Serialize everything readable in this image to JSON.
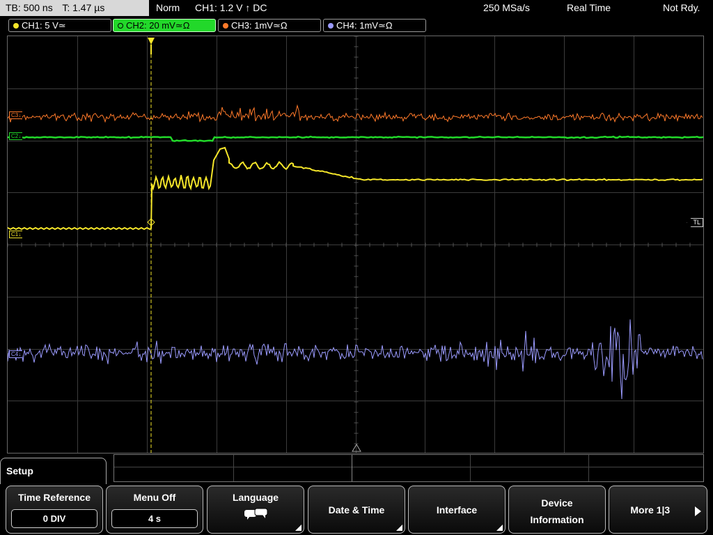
{
  "status": {
    "timebase": "TB: 500 ns",
    "trigger_time": "T: 1.47 µs",
    "mode": "Norm",
    "trigger": "CH1: 1.2 V ↑ DC",
    "sample_rate": "250 MSa/s",
    "acq": "Real Time",
    "state": "Not Rdy."
  },
  "channels": [
    {
      "label": "CH1: 5 V≃",
      "color": "#f5e62a"
    },
    {
      "label": "CH2: 20 mV≃Ω",
      "color": "#22d82a"
    },
    {
      "label": "CH3: 1mV≃Ω",
      "color": "#ff7a2a"
    },
    {
      "label": "CH4: 1mV≃Ω",
      "color": "#9b9bff"
    }
  ],
  "markers": {
    "c3": "C3↓",
    "c2": "C2↓",
    "c1": "C1↓",
    "c4": "C4↓",
    "tl": "TL"
  },
  "menu": {
    "title": "Setup",
    "time_reference": {
      "label": "Time Reference",
      "value": "0 DIV"
    },
    "menu_off": {
      "label": "Menu Off",
      "value": "4 s"
    },
    "language": {
      "label": "Language",
      "icon": "speech-bubbles-icon"
    },
    "date_time": {
      "label": "Date & Time"
    },
    "interface": {
      "label": "Interface"
    },
    "device_info": {
      "label1": "Device",
      "label2": "Information"
    },
    "more": {
      "label": "More 1|3"
    }
  },
  "colors": {
    "ch1": "#f5e62a",
    "ch2": "#22d82a",
    "ch3": "#ff7a2a",
    "ch4": "#9b9bff",
    "grid": "#3c3c3c"
  }
}
